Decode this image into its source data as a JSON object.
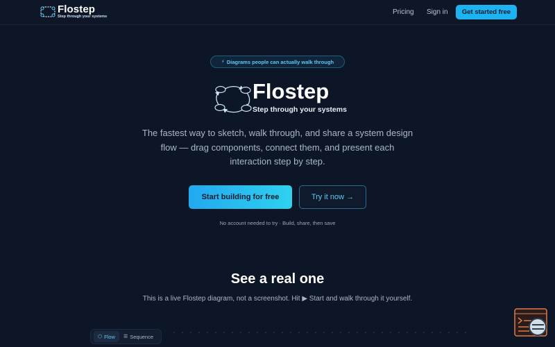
{
  "nav": {
    "brand_name": "Flostep",
    "brand_tagline": "Step through your systems",
    "links": [
      "Pricing",
      "Sign in"
    ],
    "cta_label": "Get started free"
  },
  "hero": {
    "pill_icon": "lightning-icon",
    "pill_text": "Diagrams people can actually walk through",
    "logo_name": "Flostep",
    "logo_tagline": "Step through your systems",
    "description": "The fastest way to sketch, walk through, and share a system design flow — drag components, connect them, and present each interaction step by step.",
    "primary_button": "Start building for free",
    "secondary_button": "Try it now →",
    "note": "No account needed to try · Build, share, then save"
  },
  "demo": {
    "title": "See a real one",
    "subtitle": "This is a live Flostep diagram, not a screenshot. Hit ▶ Start and walk through it yourself.",
    "tabs": [
      {
        "icon": "⬡",
        "label": "Flow",
        "active": true
      },
      {
        "icon": "☰",
        "label": "Sequence",
        "active": false
      }
    ]
  },
  "colors": {
    "background": "#0d1626",
    "accent": "#1cb3f0",
    "accent_text": "#5fc8f5",
    "widget": "#e07a4a"
  }
}
